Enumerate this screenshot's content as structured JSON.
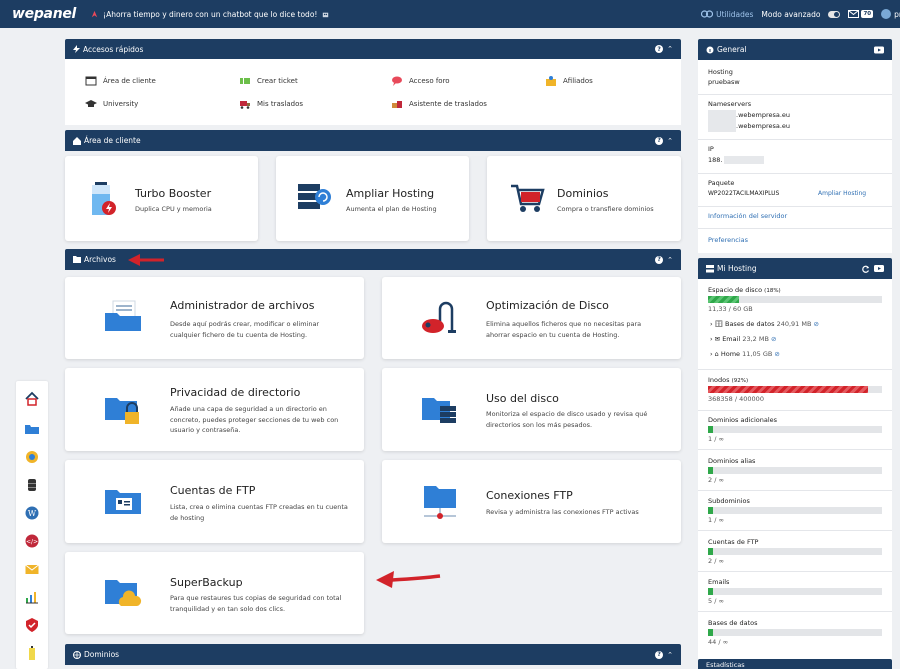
{
  "topbar": {
    "logo": "wepanel",
    "promo": "¡Ahorra tiempo y dinero con un chatbot que lo dice todo!",
    "utilidades": "Utilidades",
    "modo_avanzado": "Modo avanzado",
    "mail_badge": "70",
    "user_label": "pr"
  },
  "accesos": {
    "title": "Accesos rápidos",
    "items": [
      {
        "label": "Área de cliente",
        "icon": "window-icon"
      },
      {
        "label": "Crear ticket",
        "icon": "ticket-icon"
      },
      {
        "label": "Acceso foro",
        "icon": "chat-icon"
      },
      {
        "label": "Afiliados",
        "icon": "affiliate-icon"
      },
      {
        "label": "University",
        "icon": "graduation-cap-icon"
      },
      {
        "label": "Mis traslados",
        "icon": "truck-icon"
      },
      {
        "label": "Asistente de traslados",
        "icon": "moving-icon"
      }
    ]
  },
  "area_cliente": {
    "title": "Área de cliente",
    "cards": [
      {
        "title": "Turbo Booster",
        "desc": "Duplica CPU y memoria"
      },
      {
        "title": "Ampliar Hosting",
        "desc": "Aumenta el plan de Hosting"
      },
      {
        "title": "Dominios",
        "desc": "Compra o transfiere dominios"
      }
    ]
  },
  "archivos": {
    "title": "Archivos",
    "cards": [
      {
        "title": "Administrador de archivos",
        "desc": "Desde aquí podrás crear, modificar o eliminar cualquier fichero de tu cuenta de Hosting."
      },
      {
        "title": "Optimización de Disco",
        "desc": "Elimina aquellos ficheros que no necesitas para ahorrar espacio en tu cuenta de Hosting."
      },
      {
        "title": "Privacidad de directorio",
        "desc": "Añade una capa de seguridad a un directorio en concreto, puedes proteger secciones de tu web con usuario y contraseña."
      },
      {
        "title": "Uso del disco",
        "desc": "Monitoriza el espacio de disco usado y revisa qué directorios son los más pesados."
      },
      {
        "title": "Cuentas de FTP",
        "desc": "Lista, crea o elimina cuentas FTP creadas en tu cuenta de hosting"
      },
      {
        "title": "Conexiones FTP",
        "desc": "Revisa y administra las conexiones FTP activas"
      },
      {
        "title": "SuperBackup",
        "desc": "Para que restaures tus copias de seguridad con total tranquilidad y en tan solo dos clics."
      }
    ]
  },
  "dominios": {
    "title": "Dominios"
  },
  "general": {
    "title": "General",
    "hosting_label": "Hosting",
    "hosting_value": "pruebasw",
    "nameservers_label": "Nameservers",
    "ns1": ".webempresa.eu",
    "ns2": ".webempresa.eu",
    "ip_label": "IP",
    "ip_value": "188.",
    "paquete_label": "Paquete",
    "paquete_value": "WP2022TACILMAXIPLUS",
    "ampliar_link": "Ampliar Hosting",
    "info_link": "Información del servidor",
    "pref_link": "Preferencias"
  },
  "mi_hosting": {
    "title": "Mi Hosting",
    "disk_label": "Espacio de disco",
    "disk_pct": "(18%)",
    "disk_fraction": 0.18,
    "disk_value": "11,33 / 60 GB",
    "db_label": "Bases de datos",
    "db_value": "240,91 MB",
    "email_label": "Email",
    "email_value": "23,2 MB",
    "home_label": "Home",
    "home_value": "11,05 GB",
    "inodes_label": "Inodos",
    "inodes_pct": "(92%)",
    "inodes_fraction": 0.92,
    "inodes_value": "368358 / 400000",
    "stats": [
      {
        "label": "Dominios adicionales",
        "value": "1 / ∞",
        "fraction": 0.02
      },
      {
        "label": "Dominios alias",
        "value": "2 / ∞",
        "fraction": 0.02
      },
      {
        "label": "Subdominios",
        "value": "1 / ∞",
        "fraction": 0.02
      },
      {
        "label": "Cuentas de FTP",
        "value": "2 / ∞",
        "fraction": 0.02
      },
      {
        "label": "Emails",
        "value": "5 / ∞",
        "fraction": 0.02
      },
      {
        "label": "Bases de datos",
        "value": "44 / ∞",
        "fraction": 0.02
      }
    ]
  },
  "estadisticas": {
    "title": "Estadísticas"
  },
  "colors": {
    "navy": "#1d3d62",
    "accent_blue": "#2f6fb3",
    "green": "#2fa84a",
    "red": "#d2232a"
  }
}
